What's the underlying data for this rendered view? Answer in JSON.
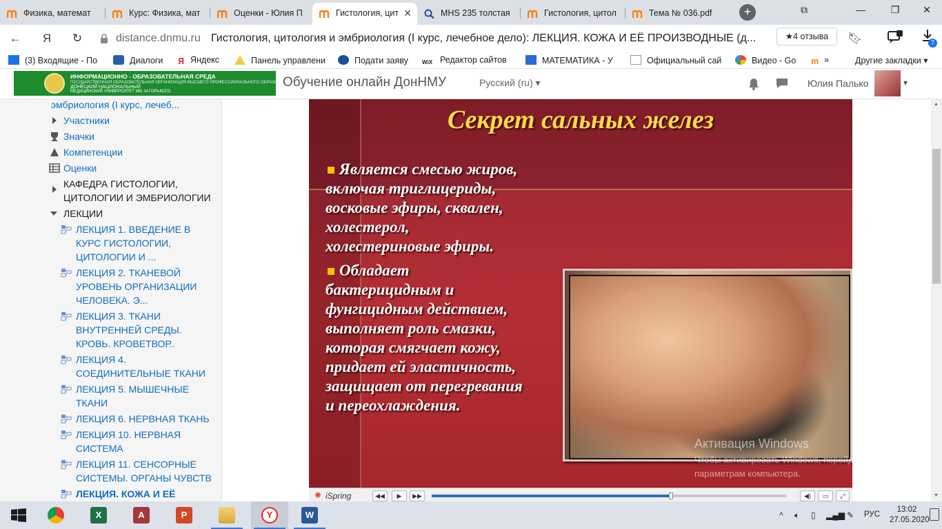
{
  "browser": {
    "tabs": [
      {
        "title": "Физика, математ",
        "active": false
      },
      {
        "title": "Курс: Физика, мат",
        "active": false
      },
      {
        "title": "Оценки - Юлия П",
        "active": false
      },
      {
        "title": "Гистология, цит",
        "active": true
      },
      {
        "title": "MHS 235 толстая",
        "active": false
      },
      {
        "title": "Гистология, цитол",
        "active": false
      },
      {
        "title": "Тема № 036.pdf",
        "active": false
      }
    ],
    "domain": "distance.dnmu.ru",
    "page_title": "Гистология, цитология и эмбриология (I курс, лечебное дело): ЛЕКЦИЯ. КОЖА И ЕЁ ПРОИЗВОДНЫЕ (д...",
    "reviews": "★4 отзыва",
    "downloads_badge": "7",
    "bookmarks": [
      "(3) Входящие - По",
      "Диалоги",
      "Яндекс",
      "Панель управлени",
      "Подати заяву",
      "Редактор сайтов",
      "МАТЕМАТИКА - У",
      "Официальный сай",
      "Видео - Go",
      "Другие закладки"
    ]
  },
  "site": {
    "logo": {
      "line1": "ИНФОРМАЦИОННО - ОБРАЗОВАТЕЛЬНАЯ СРЕДА",
      "line2": "ГОСУДАРСТВЕННАЯ ОБРАЗОВАТЕЛЬНАЯ ОРГАНИЗАЦИЯ ВЫСШЕГО ПРОФЕССИОНАЛЬНОГО ОБРАЗОВАНИЯ",
      "line3": "ДОНЕЦКИЙ НАЦИОНАЛЬНЫЙ",
      "line4": "МЕДИЦИНСКИЙ УНИВЕРСИТЕТ ИМ. М.ГОРЬКОГО"
    },
    "name": "Обучение онлайн ДонНМУ",
    "language": "Русский (ru)",
    "user": "Юлия Палько"
  },
  "sidebar": {
    "course_tail": "эмбриология (I курс, лечеб...",
    "participants": "Участники",
    "badges": "Значки",
    "competencies": "Компетенции",
    "grades": "Оценки",
    "department": [
      "КАФЕДРА ГИСТОЛОГИИ,",
      "ЦИТОЛОГИИ И ЭМБРИОЛОГИИ"
    ],
    "lectures_section": "ЛЕКЦИИ",
    "lectures": [
      [
        "ЛЕКЦИЯ 1. ВВЕДЕНИЕ В",
        "КУРС ГИСТОЛОГИИ,",
        "ЦИТОЛОГИИ И ..."
      ],
      [
        "ЛЕКЦИЯ 2. ТКАНЕВОЙ",
        "УРОВЕНЬ ОРГАНИЗАЦИИ",
        "ЧЕЛОВЕКА. Э..."
      ],
      [
        "ЛЕКЦИЯ 3. ТКАНИ",
        "ВНУТРЕННЕЙ СРЕДЫ.",
        "КРОВЬ. КРОВЕТВОР.."
      ],
      [
        "ЛЕКЦИЯ 4.",
        "СОЕДИНИТЕЛЬНЫЕ ТКАНИ"
      ],
      [
        "ЛЕКЦИЯ 5. МЫШЕЧНЫЕ",
        "ТКАНИ"
      ],
      [
        "ЛЕКЦИЯ 6. НЕРВНАЯ ТКАНЬ"
      ],
      [
        "ЛЕКЦИЯ 10. НЕРВНАЯ",
        "СИСТЕМА"
      ],
      [
        "ЛЕКЦИЯ 11. СЕНСОРНЫЕ",
        "СИСТЕМЫ. ОРГАНЫ ЧУВСТВ"
      ],
      [
        "ЛЕКЦИЯ. КОЖА И ЕЁ"
      ]
    ]
  },
  "slide": {
    "title": "Секрет сальных желез",
    "bullet1": [
      "Является смесью жиров,",
      "включая триглицериды,",
      "восковые эфиры, сквален,",
      "холестерол,",
      "холестериновые эфиры."
    ],
    "bullet2": [
      "Обладает",
      "бактерицидным и",
      "фунгицидным действием,",
      "выполняет роль смазки,",
      "которая смягчает кожу,",
      "придает ей эластичность,",
      "защищает от перегревания",
      "и переохлаждения."
    ]
  },
  "player": {
    "brand": "iSpring",
    "progress_fraction": 0.675
  },
  "watermark": {
    "title": "Активация Windows",
    "text": "Чтобы активировать Windows, перейдите к параметрам компьютера."
  },
  "taskbar": {
    "language": "РУС",
    "time": "13:02",
    "date": "27.05.2020"
  },
  "colors": {
    "moodle_accent": "#f98012",
    "slide_title": "#ffd84a",
    "link": "#0f6cbf"
  }
}
